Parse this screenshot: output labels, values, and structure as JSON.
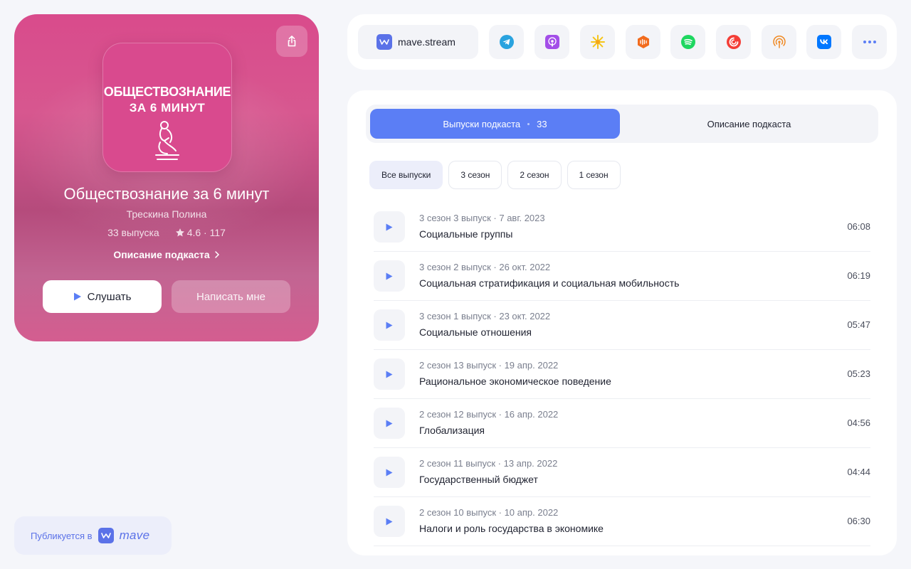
{
  "podcast": {
    "cover_line1": "ОБЩЕСТВОЗНАНИЕ",
    "cover_line2": "ЗА 6 МИНУТ",
    "title": "Обществознание за 6 минут",
    "author": "Трескина Полина",
    "episodes_count": "33 выпуска",
    "rating": "4.6 · 117",
    "description_link": "Описание подкаста",
    "listen_label": "Слушать",
    "write_label": "Написать мне"
  },
  "published": {
    "label": "Публикуется в",
    "brand": "mave"
  },
  "platforms": {
    "main_label": "mave.stream",
    "items": [
      "telegram-icon",
      "apple-podcasts-icon",
      "yandex-music-icon",
      "soundstream-icon",
      "spotify-icon",
      "pocket-casts-icon",
      "castbox-icon",
      "vk-icon",
      "more-icon"
    ]
  },
  "tabs": {
    "episodes_label": "Выпуски подкаста",
    "episodes_count": "33",
    "description_label": "Описание подкаста"
  },
  "seasons": [
    "Все выпуски",
    "3 сезон",
    "2 сезон",
    "1 сезон"
  ],
  "episodes": [
    {
      "meta": "3 сезон 3 выпуск · 7 авг. 2023",
      "title": "Социальные группы",
      "duration": "06:08"
    },
    {
      "meta": "3 сезон 2 выпуск · 26 окт. 2022",
      "title": "Социальная стратификация и социальная мобильность",
      "duration": "06:19"
    },
    {
      "meta": "3 сезон 1 выпуск · 23 окт. 2022",
      "title": "Социальные отношения",
      "duration": "05:47"
    },
    {
      "meta": "2 сезон 13 выпуск · 19 апр. 2022",
      "title": "Рациональное экономическое поведение",
      "duration": "05:23"
    },
    {
      "meta": "2 сезон 12 выпуск · 16 апр. 2022",
      "title": "Глобализация",
      "duration": "04:56"
    },
    {
      "meta": "2 сезон 11 выпуск · 13 апр. 2022",
      "title": "Государственный бюджет",
      "duration": "04:44"
    },
    {
      "meta": "2 сезон 10 выпуск · 10 апр. 2022",
      "title": "Налоги и роль государства в экономике",
      "duration": "06:30"
    }
  ],
  "colors": {
    "accent": "#5b7ef5",
    "card": "#d94b8c"
  }
}
